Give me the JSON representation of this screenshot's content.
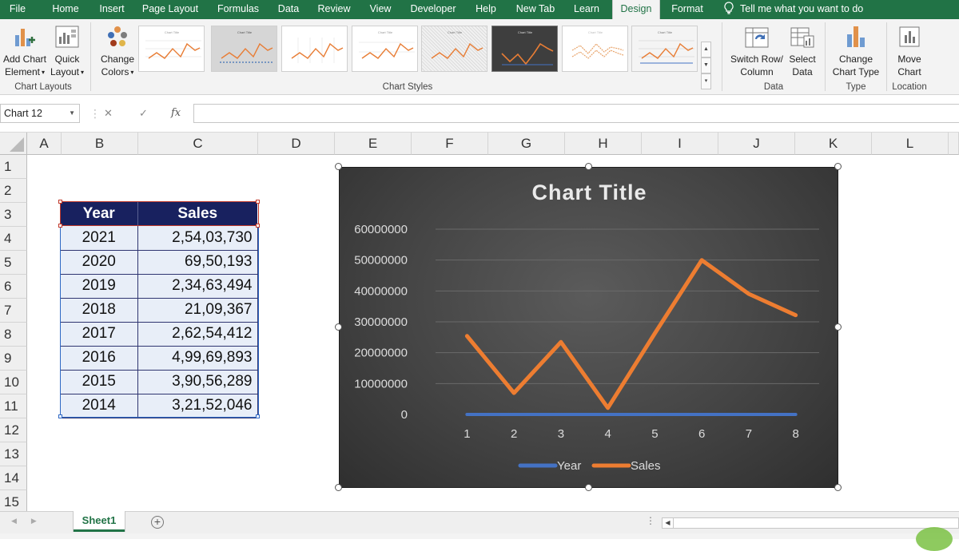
{
  "ribbon_tabs": [
    {
      "label": "File",
      "x": 0
    },
    {
      "label": "Home"
    },
    {
      "label": "Insert"
    },
    {
      "label": "Page Layout"
    },
    {
      "label": "Formulas"
    },
    {
      "label": "Data"
    },
    {
      "label": "Review"
    },
    {
      "label": "View"
    },
    {
      "label": "Developer"
    },
    {
      "label": "Help"
    },
    {
      "label": "New Tab"
    },
    {
      "label": "Learn"
    },
    {
      "label": "Design"
    },
    {
      "label": "Format"
    }
  ],
  "tell_me": "Tell me what you want to do",
  "ribbon": {
    "add_chart_element": "Add Chart",
    "add_chart_element_2": "Element",
    "quick_layout": "Quick",
    "quick_layout_2": "Layout",
    "chart_layouts_label": "Chart Layouts",
    "change_colors": "Change",
    "change_colors_2": "Colors",
    "chart_styles_label": "Chart Styles",
    "switch_row_column": "Switch Row/",
    "switch_row_column_2": "Column",
    "select_data": "Select",
    "select_data_2": "Data",
    "data_label": "Data",
    "change_chart_type": "Change",
    "change_chart_type_2": "Chart Type",
    "type_label": "Type",
    "move_chart": "Move",
    "move_chart_2": "Chart",
    "location_label": "Location",
    "thumb_title": "Chart Title"
  },
  "name_box": "Chart 12",
  "formula_icons": {
    "cancel": "✕",
    "enter": "✓",
    "fx": "fx"
  },
  "columns": [
    "A",
    "B",
    "C",
    "D",
    "E",
    "F",
    "G",
    "H",
    "I",
    "J",
    "K",
    "L"
  ],
  "rows": [
    "1",
    "2",
    "3",
    "4",
    "5",
    "6",
    "7",
    "8",
    "9",
    "10",
    "11",
    "12",
    "13",
    "14",
    "15"
  ],
  "table": {
    "headers": [
      "Year",
      "Sales"
    ],
    "rows": [
      [
        "2021",
        "2,54,03,730"
      ],
      [
        "2020",
        "69,50,193"
      ],
      [
        "2019",
        "2,34,63,494"
      ],
      [
        "2018",
        "21,09,367"
      ],
      [
        "2017",
        "2,62,54,412"
      ],
      [
        "2016",
        "4,99,69,893"
      ],
      [
        "2015",
        "3,90,56,289"
      ],
      [
        "2014",
        "3,21,52,046"
      ]
    ]
  },
  "sheet_tab": "Sheet1",
  "colors": {
    "excel_green": "#217346",
    "table_header": "#18215f",
    "year_series": "#4472c4",
    "sales_series": "#ed7d31"
  },
  "chart_data": {
    "type": "line",
    "title": "Chart Title",
    "categories": [
      "1",
      "2",
      "3",
      "4",
      "5",
      "6",
      "7",
      "8"
    ],
    "y_tick_labels": [
      "0",
      "10000000",
      "20000000",
      "30000000",
      "40000000",
      "50000000",
      "60000000"
    ],
    "ylim": [
      0,
      60000000
    ],
    "series": [
      {
        "name": "Year",
        "color": "#4472c4",
        "values": [
          2021,
          2020,
          2019,
          2018,
          2017,
          2016,
          2015,
          2014
        ]
      },
      {
        "name": "Sales",
        "color": "#ed7d31",
        "values": [
          25403730,
          6950193,
          23463494,
          2109367,
          26254412,
          49969893,
          39056289,
          32152046
        ]
      }
    ],
    "legend_position": "bottom",
    "grid": true
  }
}
